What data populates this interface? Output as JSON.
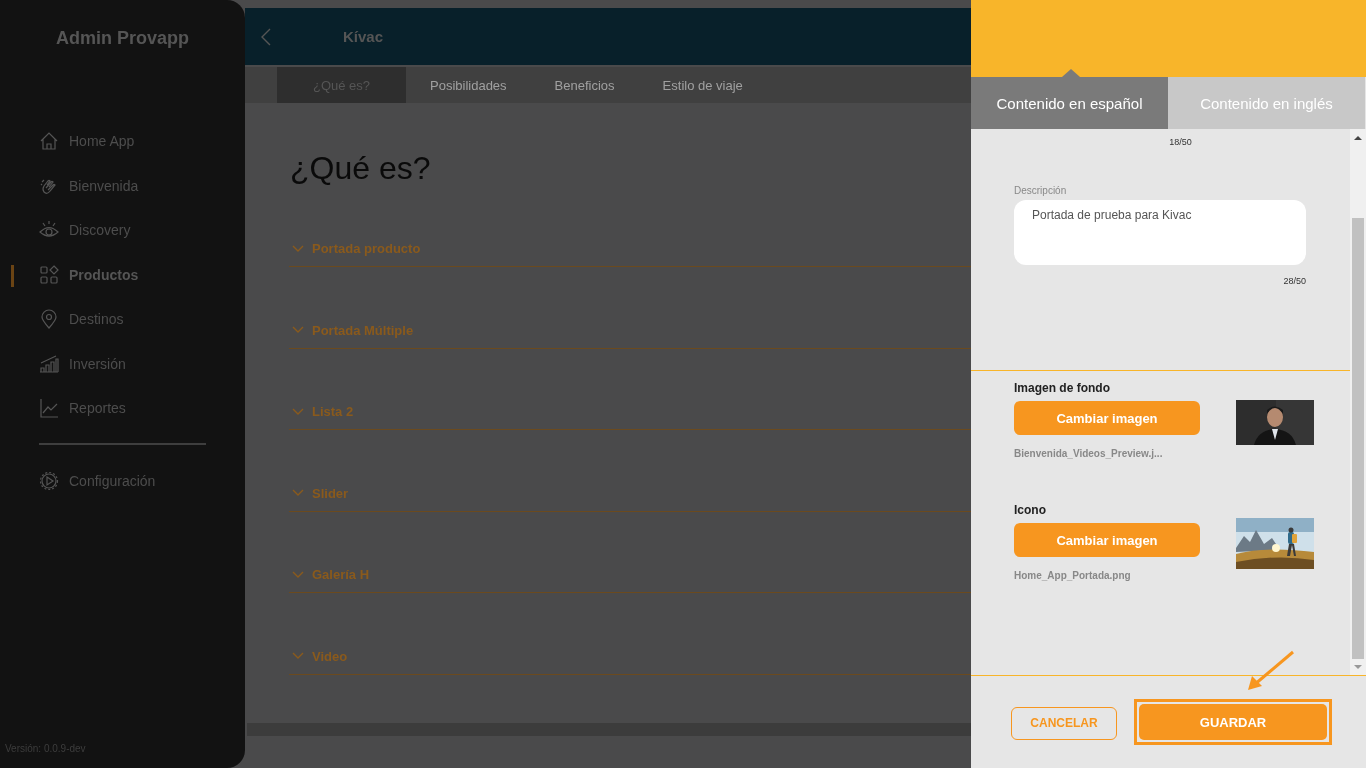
{
  "sidebar": {
    "title": "Admin Provapp",
    "items": [
      {
        "label": "Home App",
        "kind": "home",
        "selected": false
      },
      {
        "label": "Bienvenida",
        "kind": "hand",
        "selected": false
      },
      {
        "label": "Discovery",
        "kind": "eye",
        "selected": false
      },
      {
        "label": "Productos",
        "kind": "grid",
        "selected": true
      },
      {
        "label": "Destinos",
        "kind": "pin",
        "selected": false
      },
      {
        "label": "Inversión",
        "kind": "bars",
        "selected": false
      },
      {
        "label": "Reportes",
        "kind": "trend",
        "selected": false
      }
    ],
    "footer_items": [
      {
        "label": "Configuración",
        "kind": "gear",
        "selected": false
      }
    ],
    "version": "Versión: 0.0.9-dev"
  },
  "header": {
    "title": "Kívac"
  },
  "tabs": [
    {
      "label": "¿Qué es?",
      "selected": true
    },
    {
      "label": "Posibilidades",
      "selected": false
    },
    {
      "label": "Beneficios",
      "selected": false
    },
    {
      "label": "Estilo de viaje",
      "selected": false
    }
  ],
  "heading": "¿Qué es?",
  "sections": [
    {
      "label": "Portada producto"
    },
    {
      "label": "Portada Múltiple"
    },
    {
      "label": "Lista 2"
    },
    {
      "label": "Slider"
    },
    {
      "label": "Galería H"
    },
    {
      "label": "Video"
    }
  ],
  "panel": {
    "tabs": [
      {
        "label": "Contenido en español",
        "selected": true
      },
      {
        "label": "Contenido en inglés",
        "selected": false
      }
    ],
    "title_counter": "18/50",
    "description": {
      "label": "Descripción",
      "value": "Portada de prueba para Kivac",
      "counter": "28/50"
    },
    "images": [
      {
        "label": "Imagen de fondo",
        "button": "Cambiar imagen",
        "file": "Bienvenida_Videos_Preview.j...",
        "kind": "portrait"
      },
      {
        "label": "Icono",
        "button": "Cambiar imagen",
        "file": "Home_App_Portada.png",
        "kind": "landscape"
      }
    ],
    "cancel": "CANCELAR",
    "save": "GUARDAR",
    "save_highlighted": true
  }
}
